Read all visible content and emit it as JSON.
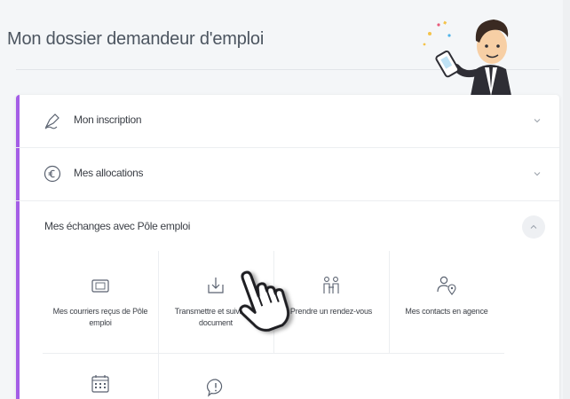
{
  "header": {
    "title": "Mon dossier demandeur d'emploi"
  },
  "accordion": {
    "items": [
      {
        "label": "Mon inscription",
        "icon": "signature-pen-icon",
        "state": "collapsed"
      },
      {
        "label": "Mes allocations",
        "icon": "euro-coin-icon",
        "state": "collapsed"
      },
      {
        "label": "Mes échanges avec Pôle emploi",
        "state": "expanded"
      }
    ]
  },
  "tiles": [
    {
      "label": "Mes courriers reçus de Pôle emploi",
      "icon": "mail-inbox-icon"
    },
    {
      "label": "Transmettre et suivre un document",
      "icon": "upload-download-icon"
    },
    {
      "label": "Prendre un rendez-vous",
      "icon": "meeting-people-icon"
    },
    {
      "label": "Mes contacts en agence",
      "icon": "contact-location-icon"
    },
    {
      "label": "",
      "icon": "calendar-icon"
    },
    {
      "label": "",
      "icon": "alert-bubble-icon"
    }
  ],
  "colors": {
    "accent": "#a45ee6",
    "text": "#3b3f46",
    "icon": "#5a6270"
  }
}
